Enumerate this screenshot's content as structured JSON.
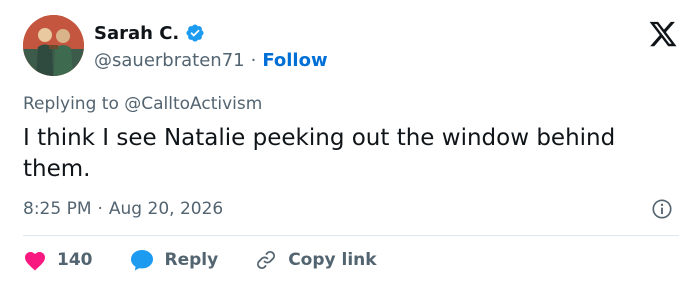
{
  "author": {
    "name": "Sarah C.",
    "handle": "@sauerbraten71",
    "separator": "·",
    "follow_label": "Follow",
    "verified_color": "#1d9bf0"
  },
  "reply": {
    "prefix": "Replying to",
    "mention": "@CalltoActivism"
  },
  "tweet": {
    "text": "I think I see Natalie peeking out the window behind them."
  },
  "meta": {
    "time": "8:25 PM",
    "separator": "·",
    "date": "Aug 20, 2026"
  },
  "actions": {
    "like_count": "140",
    "reply_label": "Reply",
    "copy_label": "Copy link"
  },
  "colors": {
    "like": "#f91880",
    "reply_bubble": "#1d9bf0",
    "follow": "#006fd6",
    "secondary_text": "#536471"
  },
  "icons": [
    "verified-badge-icon",
    "x-logo-icon",
    "info-icon",
    "heart-icon",
    "reply-bubble-icon",
    "link-icon"
  ]
}
